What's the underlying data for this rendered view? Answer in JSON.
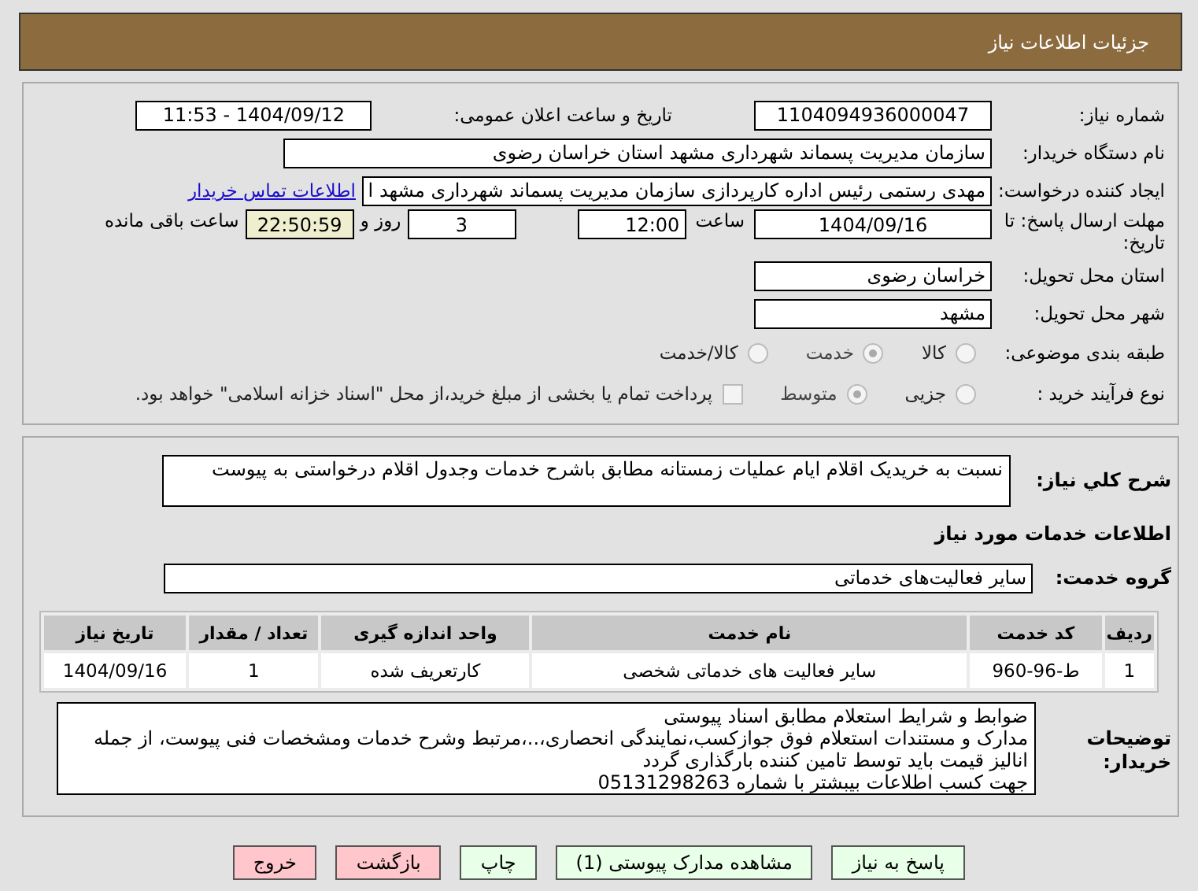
{
  "header": {
    "title": "جزئیات اطلاعات نیاز"
  },
  "info": {
    "need_number": {
      "label": "شماره نیاز:",
      "value": "1104094936000047"
    },
    "announce": {
      "label": "تاریخ و ساعت اعلان عمومی:",
      "value": "1404/09/12 - 11:53"
    },
    "buyer": {
      "label": "نام دستگاه خریدار:",
      "value": "سازمان مدیریت پسماند شهرداری مشهد استان خراسان رضوی"
    },
    "creator": {
      "label": "ایجاد کننده درخواست:",
      "value": "مهدی رستمی رئیس اداره کارپردازی سازمان مدیریت پسماند شهرداری مشهد ا",
      "link": "اطلاعات تماس خریدار"
    },
    "deadline": {
      "label": "مهلت ارسال پاسخ: تا تاریخ:",
      "date": "1404/09/16",
      "time_label": "ساعت",
      "time": "12:00",
      "days": "3",
      "days_label": "روز و",
      "remaining": "22:50:59",
      "remaining_label": "ساعت باقی مانده"
    },
    "province": {
      "label": "استان محل تحویل:",
      "value": "خراسان رضوی"
    },
    "city": {
      "label": "شهر محل تحویل:",
      "value": "مشهد"
    },
    "category": {
      "label": "طبقه بندی موضوعی:",
      "options": [
        {
          "label": "کالا",
          "selected": false
        },
        {
          "label": "خدمت",
          "selected": true
        },
        {
          "label": "کالا/خدمت",
          "selected": false
        }
      ]
    },
    "purchase": {
      "label": "نوع فرآیند خرید :",
      "options": [
        {
          "label": "جزیی",
          "selected": false
        },
        {
          "label": "متوسط",
          "selected": true
        }
      ],
      "payment": {
        "checked": false,
        "label": "پرداخت تمام یا بخشی از مبلغ خرید،از محل \"اسناد خزانه اسلامی\" خواهد بود."
      }
    }
  },
  "details": {
    "description": {
      "label": "شرح کلي نياز:",
      "value": "نسبت به خریدیک اقلام ایام عملیات زمستانه مطابق باشرح خدمات وجدول اقلام درخواستی به پیوست"
    },
    "services_title": "اطلاعات خدمات مورد نياز",
    "service_group": {
      "label": "گروه خدمت:",
      "value": "سایر فعالیت‌های خدماتی"
    },
    "table": {
      "columns": [
        "ردیف",
        "کد خدمت",
        "نام خدمت",
        "واحد اندازه گیری",
        "تعداد / مقدار",
        "تاریخ نیاز"
      ],
      "rows": [
        [
          "1",
          "ط-96-960",
          "سایر فعالیت های خدماتی شخصی",
          "کارتعریف شده",
          "1",
          "1404/09/16"
        ]
      ]
    },
    "notes": {
      "label": "توضیحات خریدار:",
      "lines": [
        "ضوابط و شرایط استعلام مطابق اسناد پیوستی",
        "مدارک و مستندات استعلام فوق جوازکسب،نمایندگی انحصاری،..،مرتبط وشرح خدمات ومشخصات فنی پیوست، از جمله",
        "انالیز قیمت باید توسط تامین کننده بارگذاری گردد",
        "جهت کسب اطلاعات بیبشتر با شماره 05131298263"
      ]
    }
  },
  "buttons": [
    {
      "label": "پاسخ به نیاز",
      "kind": "normal"
    },
    {
      "label": "مشاهده مدارک پیوستی (1)",
      "kind": "normal"
    },
    {
      "label": "چاپ",
      "kind": "normal"
    },
    {
      "label": "بازگشت",
      "kind": "danger"
    },
    {
      "label": "خروج",
      "kind": "danger"
    }
  ]
}
